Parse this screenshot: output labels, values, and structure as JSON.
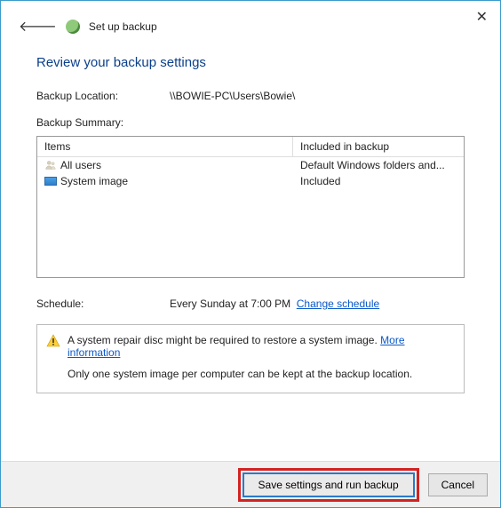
{
  "closeGlyph": "✕",
  "backGlyph": "🡐",
  "wizardTitle": "Set up backup",
  "pageTitle": "Review your backup settings",
  "locationLabel": "Backup Location:",
  "locationValue": "\\\\BOWIE-PC\\Users\\Bowie\\",
  "summaryLabel": "Backup Summary:",
  "table": {
    "col1": "Items",
    "col2": "Included in backup",
    "rows": [
      {
        "name": "All users",
        "included": "Default Windows folders and..."
      },
      {
        "name": "System image",
        "included": "Included"
      }
    ]
  },
  "scheduleLabel": "Schedule:",
  "scheduleValue": "Every Sunday at 7:00 PM",
  "changeScheduleLink": "Change schedule",
  "infoLine1a": "A system repair disc might be required to restore a system image. ",
  "moreInfoLink": "More information",
  "infoLine2": "Only one system image per computer can be kept at the backup location.",
  "primaryBtn": "Save settings and run backup",
  "cancelBtn": "Cancel"
}
